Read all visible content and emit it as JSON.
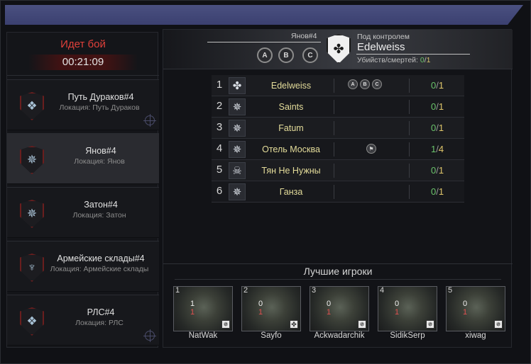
{
  "battle_status": {
    "title": "Идет бой",
    "timer": "00:21:09"
  },
  "locations": [
    {
      "name": "Путь Дураков#4",
      "sub": "Локация: Путь Дураков",
      "icon": "ornament-shield-icon",
      "glyph": "❖",
      "active": false,
      "target": true
    },
    {
      "name": "Янов#4",
      "sub": "Локация: Янов",
      "icon": "star-shield-icon",
      "glyph": "✵",
      "active": true,
      "target": false
    },
    {
      "name": "Затон#4",
      "sub": "Локация: Затон",
      "icon": "star-shield-icon",
      "glyph": "✵",
      "active": false,
      "target": false
    },
    {
      "name": "Армейские склады#4",
      "sub": "Локация: Армейские склады",
      "icon": "trident-shield-icon",
      "glyph": "♆",
      "active": false,
      "target": false
    },
    {
      "name": "РЛС#4",
      "sub": "Локация: РЛС",
      "icon": "ornament-shield-icon",
      "glyph": "❖",
      "active": false,
      "target": true
    }
  ],
  "header": {
    "location": "Янов#4",
    "control_label": "Под контролем",
    "clan": "Edelweiss",
    "kd_label": "Убийств/смертей:",
    "kills": "0",
    "deaths": "1",
    "points": [
      "A",
      "B",
      "C"
    ]
  },
  "clans": [
    {
      "rank": "1",
      "name": "Edelweiss",
      "glyph": "✤",
      "kills": "0",
      "deaths": "1",
      "points": [
        "A",
        "B",
        "C"
      ],
      "flag": false
    },
    {
      "rank": "2",
      "name": "Saints",
      "glyph": "✵",
      "kills": "0",
      "deaths": "1",
      "points": [],
      "flag": false
    },
    {
      "rank": "3",
      "name": "Fatum",
      "glyph": "✵",
      "kills": "0",
      "deaths": "1",
      "points": [],
      "flag": false
    },
    {
      "rank": "4",
      "name": "Отель Москва",
      "glyph": "✵",
      "kills": "1",
      "deaths": "4",
      "points": [],
      "flag": true
    },
    {
      "rank": "5",
      "name": "Тян Не Нужны",
      "glyph": "☠",
      "kills": "0",
      "deaths": "1",
      "points": [],
      "flag": false
    },
    {
      "rank": "6",
      "name": "Ганза",
      "glyph": "✵",
      "kills": "0",
      "deaths": "1",
      "points": [],
      "flag": false
    }
  ],
  "best_players": {
    "title": "Лучшие игроки",
    "players": [
      {
        "num": "1",
        "name": "NatWak",
        "kills": "1",
        "deaths": "1",
        "badge": "✵"
      },
      {
        "num": "2",
        "name": "Sayfo",
        "kills": "0",
        "deaths": "1",
        "badge": "✤"
      },
      {
        "num": "3",
        "name": "Ackwadarchik",
        "kills": "0",
        "deaths": "1",
        "badge": "✵"
      },
      {
        "num": "4",
        "name": "SidikSerp",
        "kills": "0",
        "deaths": "1",
        "badge": "✵"
      },
      {
        "num": "5",
        "name": "xiwag",
        "kills": "0",
        "deaths": "1",
        "badge": "✵"
      }
    ]
  },
  "colors": {
    "accent_blue": "#4a5080",
    "status_red": "#e0403a",
    "kills_green": "#6bc46b",
    "deaths_gold": "#e0c66a",
    "clan_name_gold": "#e4dc9a"
  }
}
